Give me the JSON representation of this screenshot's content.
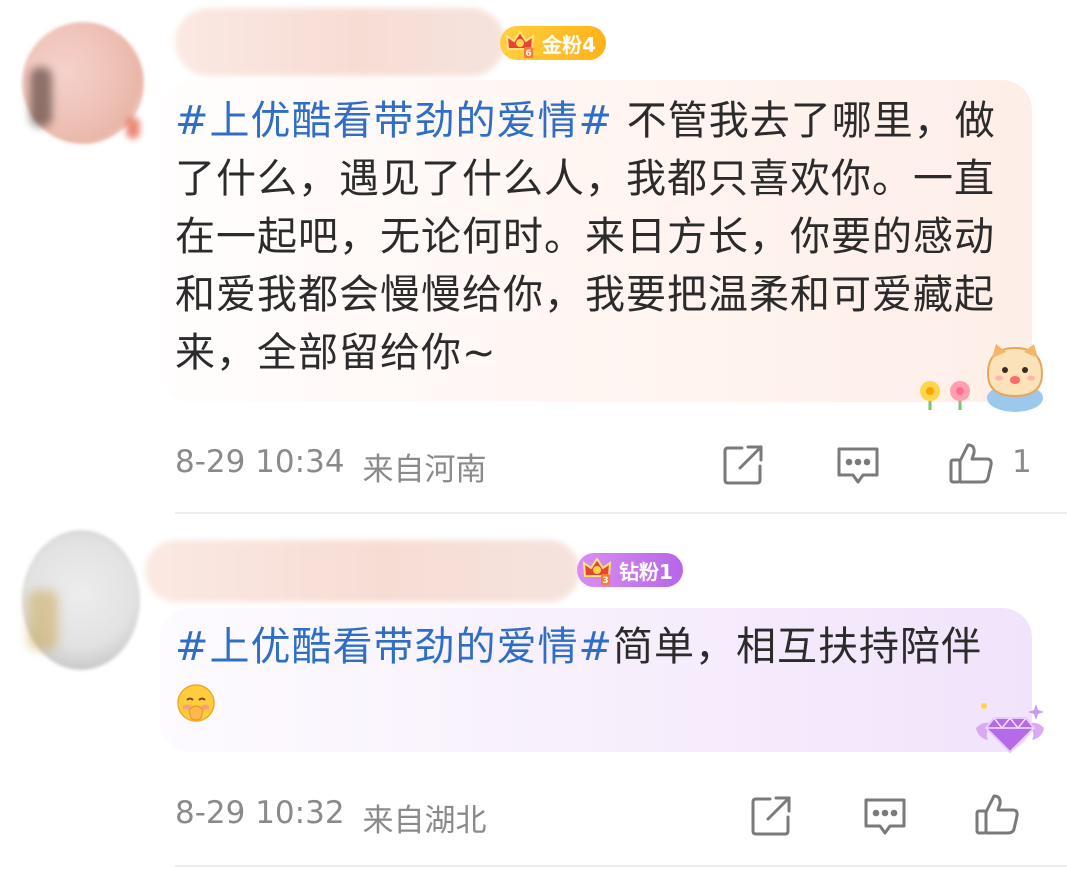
{
  "comments": [
    {
      "badge": "金粉4",
      "badge_level": "6",
      "topic": "#上优酷看带劲的爱情#",
      "text": " 不管我去了哪里，做了什么，遇见了什么人，我都只喜欢你。一直在一起吧，无论何时。来日方长，你要的感动和爱我都会慢慢给你，我要把温柔和可爱藏起来，全部留给你~",
      "time": "8-29 10:34",
      "location": "来自河南",
      "likes": "1",
      "colors": {
        "badge": "#ffb21a",
        "bubble": "#feeee8"
      }
    },
    {
      "badge": "钻粉1",
      "badge_level": "3",
      "topic": "#上优酷看带劲的爱情#",
      "text": "简单，相互扶持陪伴",
      "time": "8-29 10:32",
      "location": "来自湖北",
      "likes": "",
      "colors": {
        "badge": "#b666e8",
        "bubble": "#f1e3fb"
      }
    }
  ],
  "icons": {
    "repost": "share-box-icon",
    "reply": "comment-bubble-icon",
    "like": "thumbs-up-icon",
    "crown": "crown-icon",
    "cat": "cat-sticker-icon",
    "diamond": "diamond-wings-icon",
    "emoji": "shy-face-emoji"
  },
  "colors": {
    "topic": "#2f6ec6",
    "meta": "#8a8a8a",
    "text": "#2b2b2b"
  }
}
